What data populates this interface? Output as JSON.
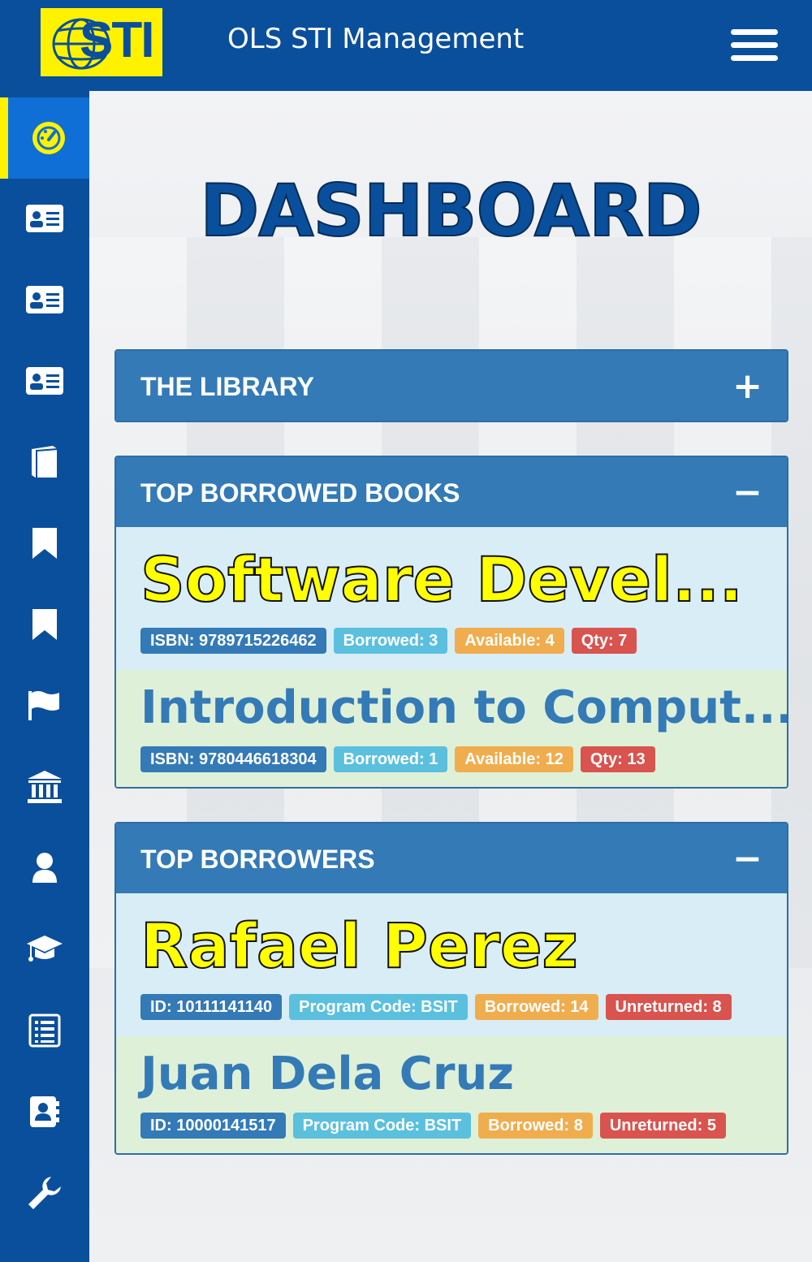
{
  "header": {
    "logo_text": "STI",
    "app_title": "OLS STI Management"
  },
  "sidebar": {
    "items": [
      {
        "icon": "dashboard-icon",
        "active": true
      },
      {
        "icon": "id-card-icon"
      },
      {
        "icon": "id-card-icon"
      },
      {
        "icon": "id-card-icon"
      },
      {
        "icon": "book-icon"
      },
      {
        "icon": "bookmark-icon"
      },
      {
        "icon": "bookmark-icon"
      },
      {
        "icon": "flag-icon"
      },
      {
        "icon": "bank-icon"
      },
      {
        "icon": "user-icon"
      },
      {
        "icon": "graduation-cap-icon"
      },
      {
        "icon": "list-icon"
      },
      {
        "icon": "address-book-icon"
      },
      {
        "icon": "wrench-icon"
      }
    ]
  },
  "main": {
    "title": "DASHBOARD",
    "library_panel": {
      "title": "THE LIBRARY",
      "toggle": "+"
    },
    "books_panel": {
      "title": "TOP BORROWED BOOKS",
      "toggle": "−",
      "items": [
        {
          "name": "Software Devel...",
          "isbn": "ISBN: 9789715226462",
          "borrowed": "Borrowed: 3",
          "available": "Available: 4",
          "qty": "Qty: 7"
        },
        {
          "name": "Introduction to Comput...",
          "isbn": "ISBN: 9780446618304",
          "borrowed": "Borrowed: 1",
          "available": "Available: 12",
          "qty": "Qty: 13"
        }
      ]
    },
    "borrowers_panel": {
      "title": "TOP BORROWERS",
      "toggle": "−",
      "items": [
        {
          "name": "Rafael Perez",
          "id": "ID: 10111141140",
          "program": "Program Code: BSIT",
          "borrowed": "Borrowed: 14",
          "unreturned": "Unreturned: 8"
        },
        {
          "name": "Juan Dela Cruz",
          "id": "ID: 10000141517",
          "program": "Program Code: BSIT",
          "borrowed": "Borrowed: 8",
          "unreturned": "Unreturned: 5"
        }
      ]
    }
  },
  "colors": {
    "brand_blue": "#0a4f9c",
    "brand_yellow": "#fff200",
    "panel_blue": "#337ab7"
  }
}
